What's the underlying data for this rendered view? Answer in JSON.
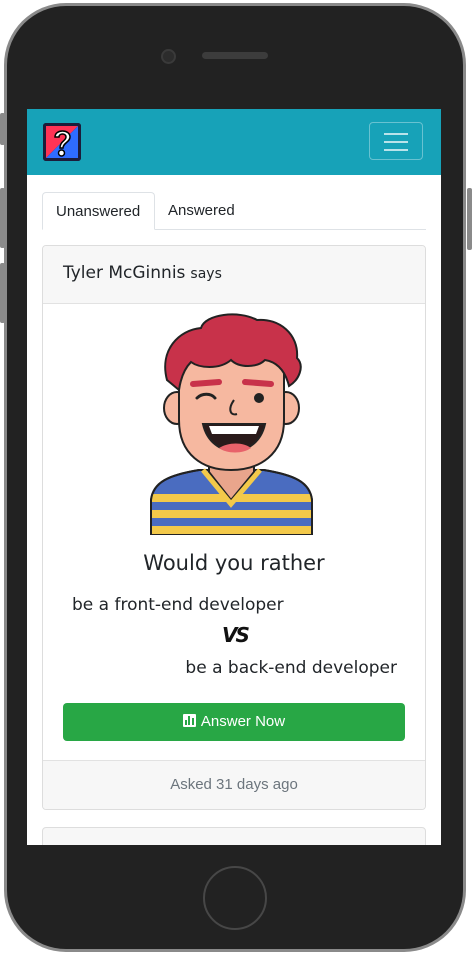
{
  "tabs": [
    {
      "label": "Unanswered"
    },
    {
      "label": "Answered"
    }
  ],
  "question": {
    "author": "Tyler McGinnis",
    "says": "says",
    "title": "Would you rather",
    "option_one": "be a front-end developer",
    "vs": "VS",
    "option_two": "be a back-end developer",
    "answer_button": "Answer Now",
    "footer": "Asked 31 days ago"
  },
  "colors": {
    "navbar": "#17a2b8",
    "answer_button": "#28a745"
  },
  "icons": {
    "logo": "question-mark-logo-icon",
    "menu": "hamburger-menu-icon",
    "answer": "bar-chart-icon"
  }
}
